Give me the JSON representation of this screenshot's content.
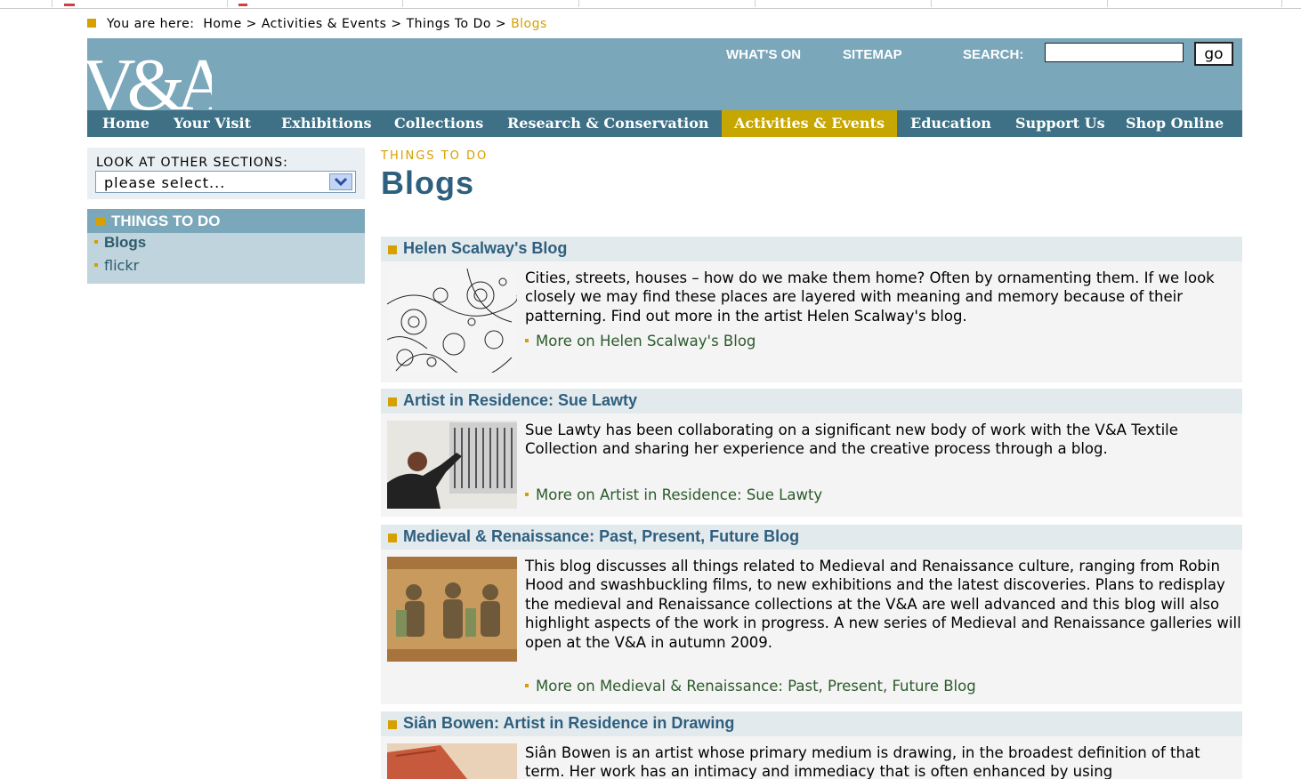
{
  "breadcrumb": {
    "prefix": "You are here:",
    "items": [
      "Home",
      "Activities & Events",
      "Things To Do"
    ],
    "separator": ">",
    "current": "Blogs"
  },
  "logo": {
    "text": "V&A"
  },
  "header_links": {
    "whats_on": "WHAT'S ON",
    "sitemap": "SITEMAP"
  },
  "search": {
    "label": "SEARCH:",
    "value": "",
    "button": "go"
  },
  "nav": {
    "items": [
      "Home",
      "Your Visit",
      "Exhibitions",
      "Collections",
      "Research & Conservation",
      "Activities & Events",
      "Education",
      "Support Us",
      "Shop Online"
    ],
    "active": "Activities & Events"
  },
  "sidebar": {
    "look_label": "LOOK AT OTHER SECTIONS:",
    "select_value": "please select...",
    "section_title": "THINGS TO DO",
    "items": [
      {
        "label": "Blogs",
        "active": true
      },
      {
        "label": "flickr",
        "active": false
      }
    ]
  },
  "main": {
    "kicker": "THINGS TO DO",
    "title": "Blogs",
    "blogs": [
      {
        "title": "Helen Scalway's Blog",
        "description": "Cities, streets, houses – how do we make them home? Often by ornamenting them. If we look closely we may find these places are layered with meaning and memory because of their patterning. Find out more in the artist Helen Scalway's blog.",
        "more": "More on Helen Scalway's Blog",
        "thumbnail": "pattern-drawing-image"
      },
      {
        "title": "Artist in Residence: Sue Lawty",
        "description": "Sue Lawty has been collaborating on a significant new body of work with the V&A Textile Collection and sharing her experience and the creative process through a blog.",
        "more": "More on Artist in Residence: Sue Lawty",
        "thumbnail": "artist-at-work-image"
      },
      {
        "title": "Medieval & Renaissance: Past, Present, Future Blog",
        "description": "This blog discusses all things related to Medieval and Renaissance culture, ranging from Robin Hood and swashbuckling films, to new exhibitions and the latest discoveries. Plans to redisplay the medieval and Renaissance collections at the V&A are well advanced and this blog will also highlight aspects of the work in progress. A new series of Medieval and Renaissance galleries will open at the V&A in autumn 2009.",
        "more": "More on Medieval & Renaissance: Past, Present, Future Blog",
        "thumbnail": "medieval-tapestry-image"
      },
      {
        "title": "Siân Bowen: Artist in Residence in Drawing",
        "description": "Siân Bowen is an artist whose primary medium is drawing, in the broadest definition of that term. Her work has an intimacy and immediacy that is often enhanced by using",
        "thumbnail": "drawing-artwork-image"
      }
    ]
  },
  "colors": {
    "brand": "#7ba7ba",
    "nav": "#3e7186",
    "nav_active": "#c6a600",
    "accent": "#d6a000",
    "title": "#2e5f7e",
    "link_green": "#2c5a2c"
  }
}
